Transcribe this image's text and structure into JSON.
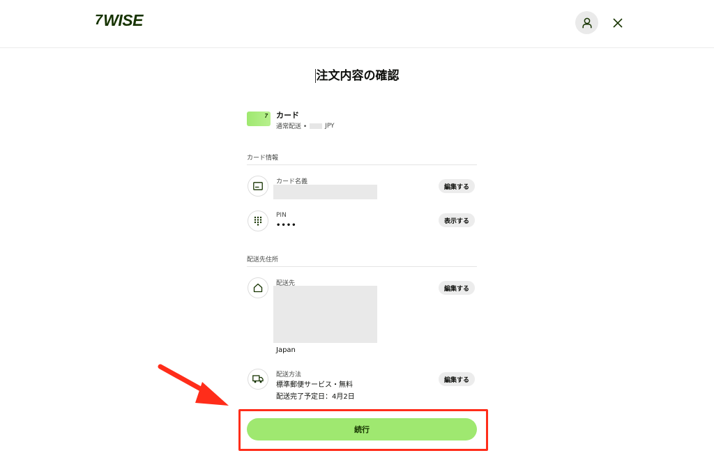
{
  "header": {
    "logo_mark": "7",
    "logo_text": "WISE",
    "avatar_icon": "user-icon",
    "close_icon": "close-icon"
  },
  "page": {
    "title": "注文内容の確認"
  },
  "card": {
    "name": "カード",
    "sub_prefix": "通常配送 •",
    "sub_suffix": "JPY",
    "thumb_mark": "7"
  },
  "card_info": {
    "section_label": "カード情報",
    "name_field": {
      "label": "カード名義",
      "action": "編集する",
      "icon": "id-card-icon"
    },
    "pin_field": {
      "label": "PIN",
      "value": "••••",
      "action": "表示する",
      "icon": "keypad-icon"
    }
  },
  "shipping": {
    "section_label": "配送先住所",
    "address": {
      "label": "配送先",
      "country": "Japan",
      "action": "編集する",
      "icon": "home-icon"
    },
    "method": {
      "label": "配送方法",
      "line1": "標準郵便サービス・無料",
      "line2": "配送完了予定日：4月2日",
      "action": "編集する",
      "icon": "truck-icon"
    }
  },
  "cta": {
    "label": "続行"
  },
  "colors": {
    "brand_green": "#9fe870",
    "brand_dark": "#163300",
    "annotation_red": "#ff2d1a"
  }
}
